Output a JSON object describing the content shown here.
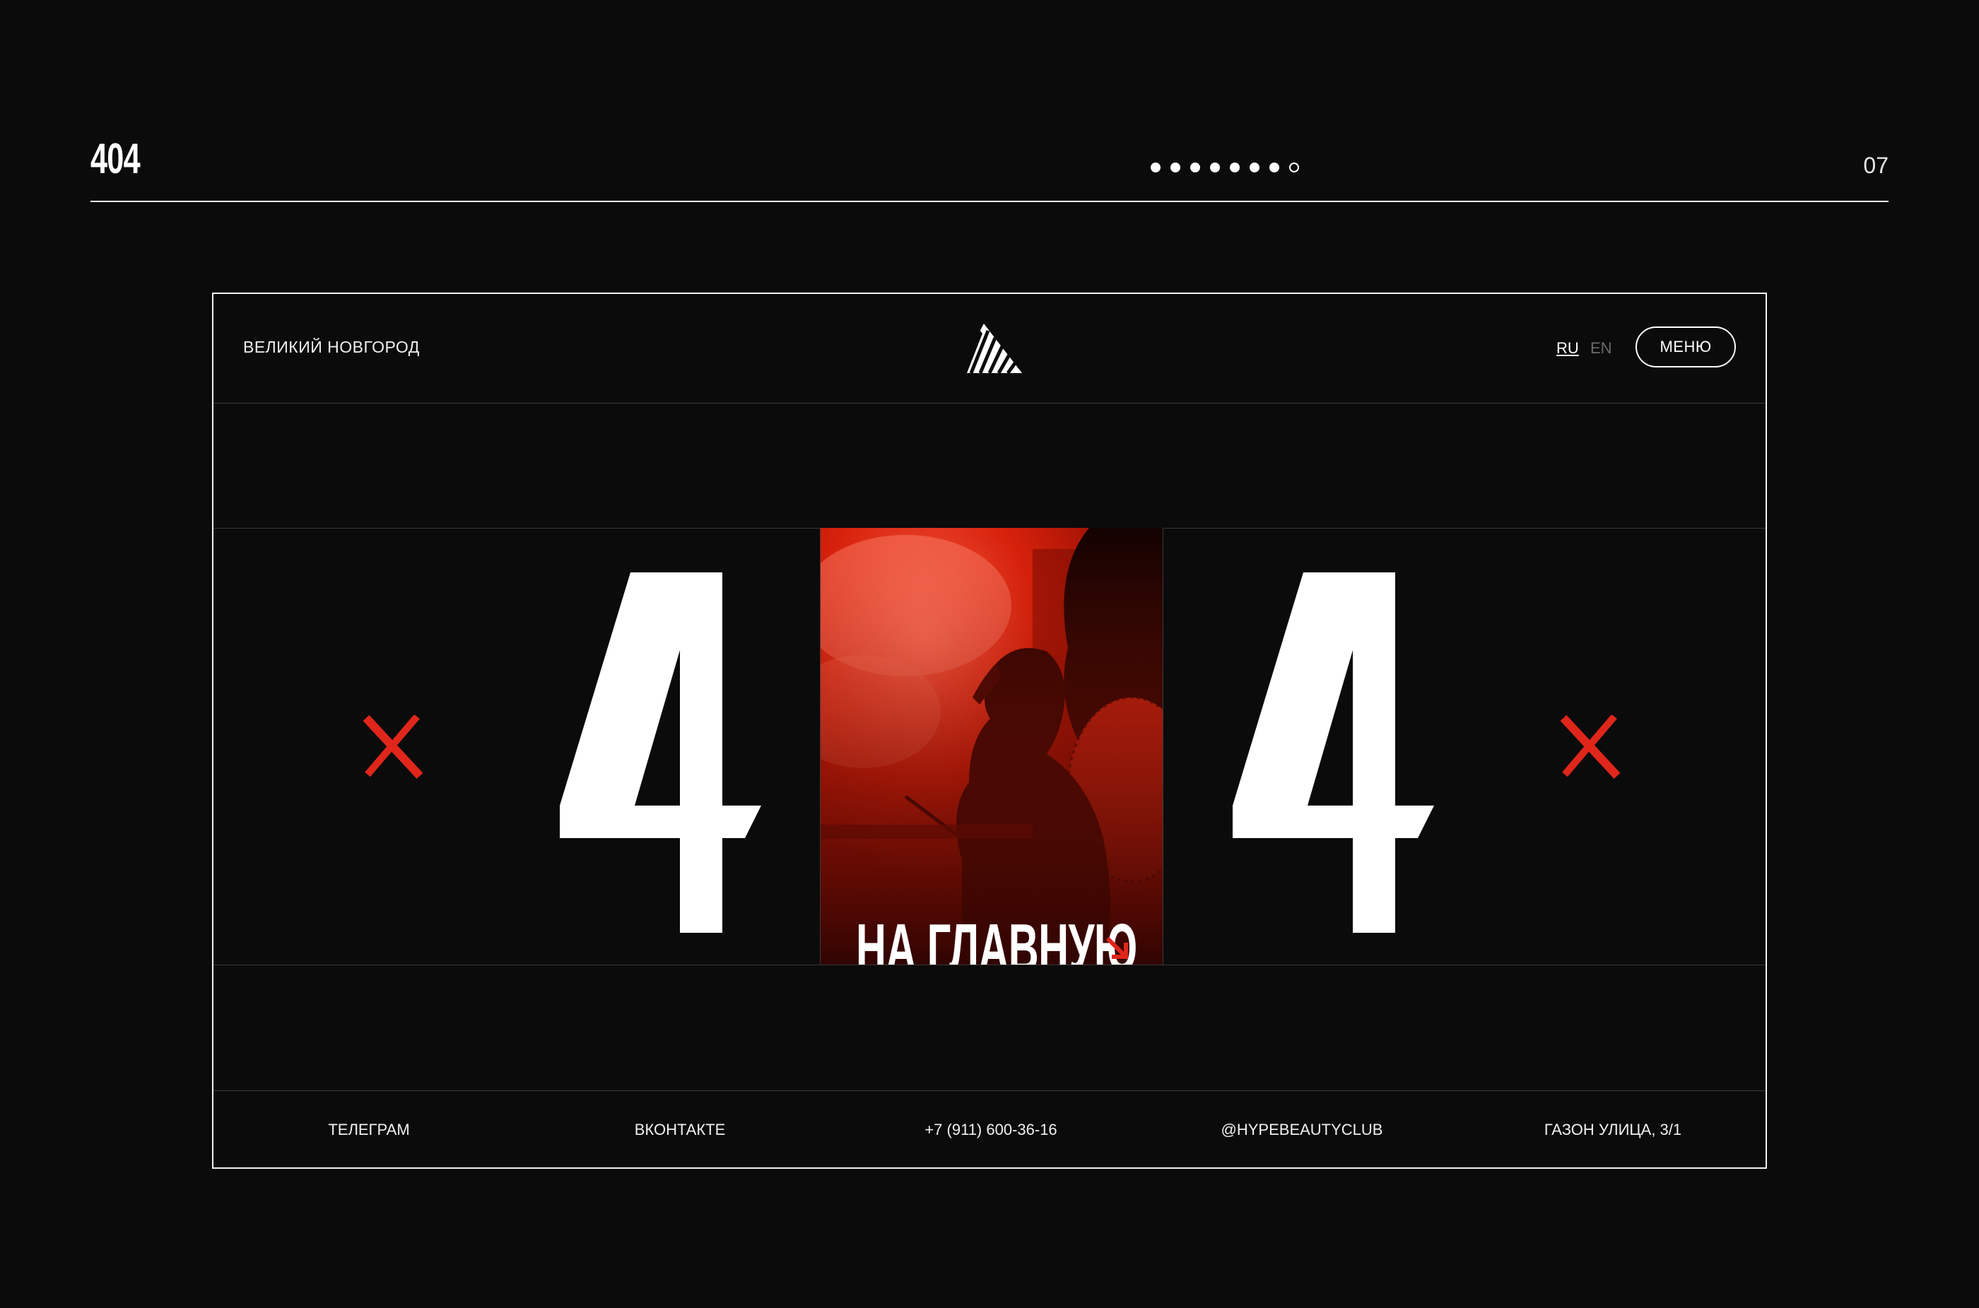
{
  "slide": {
    "title": "404",
    "number": "07",
    "pager": {
      "total": 8,
      "active": 7
    }
  },
  "site": {
    "city": "ВЕЛИКИЙ НОВГОРОД",
    "logo_icon": "triangle-stripes-logo",
    "lang": {
      "ru": "RU",
      "en": "EN",
      "active": "RU"
    },
    "menu_label": "МЕНЮ",
    "error_digit_left": "4",
    "error_digit_right": "4",
    "home_cta_label": "НА ГЛАВНУЮ",
    "accent_color": "#e0261a",
    "footer": {
      "links": [
        "ТЕЛЕГРАМ",
        "ВКОНТАКТЕ",
        "+7 (911) 600-36-16",
        "@HYPEBEAUTYCLUB",
        "ГАЗОН УЛИЦА, 3/1"
      ]
    }
  }
}
